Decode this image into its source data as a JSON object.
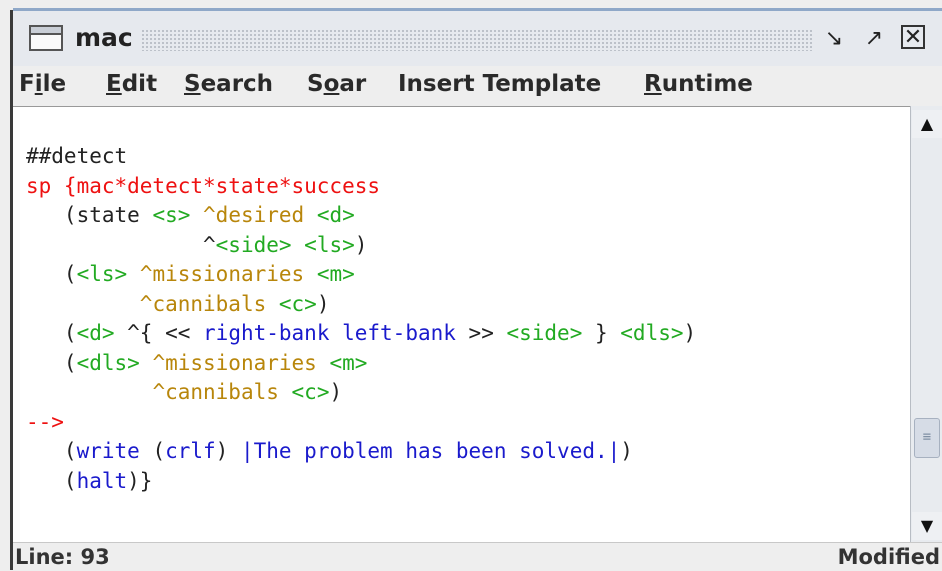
{
  "window": {
    "title": "mac",
    "buttons": {
      "minimize": "ᵅ",
      "maximize": "⧉",
      "close": "✕"
    }
  },
  "menu": {
    "items": [
      {
        "pre": "F",
        "ul": "i",
        "post": "le"
      },
      {
        "pre": "",
        "ul": "E",
        "post": "dit"
      },
      {
        "pre": "",
        "ul": "S",
        "post": "earch"
      },
      {
        "pre": "S",
        "ul": "o",
        "post": "ar"
      },
      {
        "pre": "Insert Template",
        "ul": "",
        "post": ""
      },
      {
        "pre": "",
        "ul": "R",
        "post": "untime"
      }
    ]
  },
  "editor": {
    "lines": [
      [
        {
          "t": "##detect",
          "c": "plain"
        }
      ],
      [
        {
          "t": "sp {mac*detect*state*success",
          "c": "red"
        }
      ],
      [
        {
          "t": "   (state ",
          "c": "plain"
        },
        {
          "t": "<s>",
          "c": "var"
        },
        {
          "t": " ",
          "c": "plain"
        },
        {
          "t": "^desired",
          "c": "attr"
        },
        {
          "t": " ",
          "c": "plain"
        },
        {
          "t": "<d>",
          "c": "var"
        }
      ],
      [
        {
          "t": "              ^",
          "c": "plain"
        },
        {
          "t": "<side>",
          "c": "var"
        },
        {
          "t": " ",
          "c": "plain"
        },
        {
          "t": "<ls>",
          "c": "var"
        },
        {
          "t": ")",
          "c": "plain"
        }
      ],
      [
        {
          "t": "   (",
          "c": "plain"
        },
        {
          "t": "<ls>",
          "c": "var"
        },
        {
          "t": " ",
          "c": "plain"
        },
        {
          "t": "^missionaries",
          "c": "attr"
        },
        {
          "t": " ",
          "c": "plain"
        },
        {
          "t": "<m>",
          "c": "var"
        }
      ],
      [
        {
          "t": "         ",
          "c": "plain"
        },
        {
          "t": "^cannibals",
          "c": "attr"
        },
        {
          "t": " ",
          "c": "plain"
        },
        {
          "t": "<c>",
          "c": "var"
        },
        {
          "t": ")",
          "c": "plain"
        }
      ],
      [
        {
          "t": "   (",
          "c": "plain"
        },
        {
          "t": "<d>",
          "c": "var"
        },
        {
          "t": " ^{ << ",
          "c": "plain"
        },
        {
          "t": "right-bank left-bank",
          "c": "blue"
        },
        {
          "t": " >> ",
          "c": "plain"
        },
        {
          "t": "<side>",
          "c": "var"
        },
        {
          "t": " } ",
          "c": "plain"
        },
        {
          "t": "<dls>",
          "c": "var"
        },
        {
          "t": ")",
          "c": "plain"
        }
      ],
      [
        {
          "t": "   (",
          "c": "plain"
        },
        {
          "t": "<dls>",
          "c": "var"
        },
        {
          "t": " ",
          "c": "plain"
        },
        {
          "t": "^missionaries",
          "c": "attr"
        },
        {
          "t": " ",
          "c": "plain"
        },
        {
          "t": "<m>",
          "c": "var"
        }
      ],
      [
        {
          "t": "          ",
          "c": "plain"
        },
        {
          "t": "^cannibals",
          "c": "attr"
        },
        {
          "t": " ",
          "c": "plain"
        },
        {
          "t": "<c>",
          "c": "var"
        },
        {
          "t": ")",
          "c": "plain"
        }
      ],
      [
        {
          "t": "-->",
          "c": "red"
        }
      ],
      [
        {
          "t": "   (",
          "c": "plain"
        },
        {
          "t": "write",
          "c": "blue"
        },
        {
          "t": " (",
          "c": "plain"
        },
        {
          "t": "crlf",
          "c": "blue"
        },
        {
          "t": ") ",
          "c": "plain"
        },
        {
          "t": "|The problem has been solved.|",
          "c": "blue"
        },
        {
          "t": ")",
          "c": "plain"
        }
      ],
      [
        {
          "t": "   (",
          "c": "plain"
        },
        {
          "t": "halt",
          "c": "blue"
        },
        {
          "t": ")}",
          "c": "plain"
        }
      ]
    ]
  },
  "status": {
    "line": "Line: 93",
    "state": "Modified"
  },
  "colors": {
    "plain": "#222222",
    "red": "#ee1111",
    "var": "#22aa22",
    "attr": "#b8860b",
    "blue": "#1a1acc"
  },
  "icons": {
    "window_icon": "window-icon",
    "scroll_up": "arrow-up-icon",
    "scroll_down": "arrow-down-icon"
  }
}
